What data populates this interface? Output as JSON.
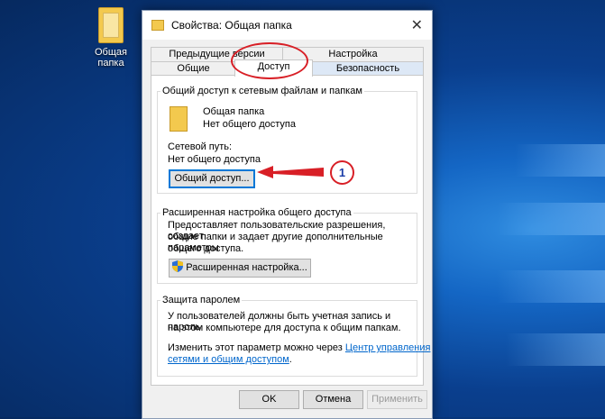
{
  "desktop": {
    "folder_label_line1": "Общая",
    "folder_label_line2": "папка"
  },
  "window": {
    "title": "Свойства: Общая папка",
    "close_symbol": "✕"
  },
  "tabs": {
    "row1": [
      "Предыдущие версии",
      "Настройка"
    ],
    "row2": [
      "Общие",
      "Доступ",
      "Безопасность"
    ]
  },
  "network_sharing": {
    "title": "Общий доступ к сетевым файлам и папкам",
    "item_name": "Общая папка",
    "item_status": "Нет общего доступа",
    "path_label": "Сетевой путь:",
    "path_value": "Нет общего доступа",
    "share_button": "Общий доступ..."
  },
  "advanced_sharing": {
    "title": "Расширенная настройка общего доступа",
    "desc_line1": "Предоставляет пользовательские разрешения, создает",
    "desc_line2": "общие папки и задает другие дополнительные параметры",
    "desc_line3": "общего доступа.",
    "button": "Расширенная настройка..."
  },
  "password_protection": {
    "title": "Защита паролем",
    "desc_line1": "У пользователей должны быть учетная запись и пароль",
    "desc_line2": "на этом компьютере для доступа к общим папкам.",
    "change_text": "Изменить этот параметр можно через",
    "link_line1": "Центр управления",
    "link_line2": "сетями и общим доступом",
    "link_suffix": "."
  },
  "footer": {
    "ok": "OK",
    "cancel": "Отмена",
    "apply": "Применить"
  },
  "annotation": {
    "step_number": "1",
    "accent_color": "#d81f26",
    "number_color": "#1b3da8"
  }
}
